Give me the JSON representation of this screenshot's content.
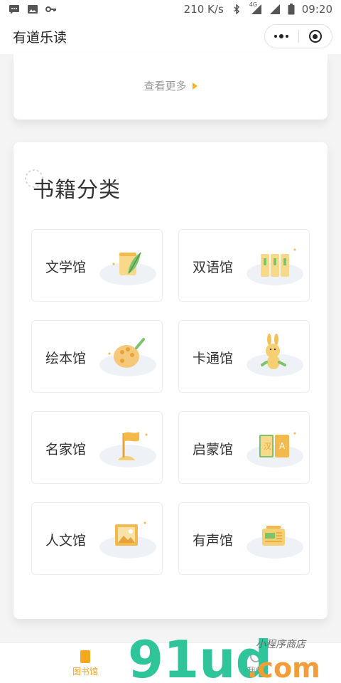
{
  "status_bar": {
    "network_speed": "210 K/s",
    "network_type": "4G",
    "time": "09:20",
    "icons": [
      "chat-icon",
      "image-icon",
      "key-icon",
      "bluetooth-icon",
      "signal-icon",
      "battery-icon"
    ]
  },
  "nav": {
    "title": "有道乐读",
    "more_icon": "more-dots-icon",
    "close_icon": "target-icon"
  },
  "top_card": {
    "see_more": "查看更多"
  },
  "category": {
    "title": "书籍分类",
    "items": [
      {
        "label": "文学馆",
        "icon": "feather-scroll-icon"
      },
      {
        "label": "双语馆",
        "icon": "books-icon"
      },
      {
        "label": "绘本馆",
        "icon": "palette-icon"
      },
      {
        "label": "卡通馆",
        "icon": "rabbit-icon"
      },
      {
        "label": "名家馆",
        "icon": "flag-icon"
      },
      {
        "label": "启蒙馆",
        "icon": "letter-book-icon"
      },
      {
        "label": "人文馆",
        "icon": "picture-frame-icon"
      },
      {
        "label": "有声馆",
        "icon": "radio-icon"
      }
    ]
  },
  "tabbar": {
    "items": [
      {
        "label": "图书馆",
        "active": true,
        "icon": "book-icon"
      },
      {
        "label": "我的",
        "active": false,
        "icon": "user-icon"
      }
    ]
  },
  "watermark": {
    "brand": "91ud",
    "suffix": ".com",
    "tagline": "小程序商店"
  },
  "colors": {
    "accent": "#f3a01e",
    "leaf_green": "#7cc36b",
    "watermark_green": "#2fc49a",
    "watermark_orange": "#f39c3a"
  }
}
